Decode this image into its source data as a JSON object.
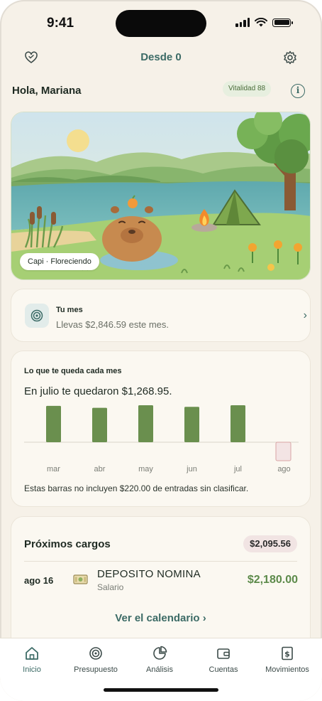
{
  "status_bar": {
    "time": "9:41"
  },
  "header": {
    "title": "Desde 0",
    "left_icon": "heart-icon",
    "right_icon": "gear-icon"
  },
  "greeting": {
    "text": "Hola, Mariana",
    "vitality_badge": "Vitalidad 88",
    "info_icon": "info-icon"
  },
  "scene": {
    "tag": "Capi · Floreciendo"
  },
  "month_card": {
    "title": "Tu mes",
    "subtitle": "Llevas $2,846.59 este mes.",
    "icon": "target-icon",
    "chevron": "›"
  },
  "leftover_card": {
    "title": "Lo que te queda cada mes",
    "summary": "En julio te quedaron $1,268.95.",
    "note": "Estas barras no incluyen $220.00 de entradas sin clasificar."
  },
  "chart_data": {
    "type": "bar",
    "categories": [
      "mar",
      "abr",
      "may",
      "jun",
      "jul",
      "ago"
    ],
    "values": [
      1250,
      1180,
      1270,
      1215,
      1268.95,
      0
    ],
    "highlight_last_as_pending": true,
    "colors": {
      "bar": "#6a8f4e",
      "pending": "#f3e4e4",
      "pending_border": "#d9a5a5"
    }
  },
  "charges_card": {
    "title": "Próximos cargos",
    "total": "$2,095.56",
    "items": [
      {
        "date": "ago 16",
        "icon": "cash-icon",
        "name": "DEPOSITO NOMINA",
        "category": "Salario",
        "amount": "$2,180.00"
      }
    ],
    "calendar_link": "Ver el calendario  ›"
  },
  "tab_bar": {
    "items": [
      {
        "label": "Inicio",
        "icon": "home-icon",
        "active": true
      },
      {
        "label": "Presupuesto",
        "icon": "target-icon",
        "active": false
      },
      {
        "label": "Análisis",
        "icon": "pie-chart-icon",
        "active": false
      },
      {
        "label": "Cuentas",
        "icon": "wallet-icon",
        "active": false
      },
      {
        "label": "Movimientos",
        "icon": "receipt-icon",
        "active": false
      }
    ]
  },
  "colors": {
    "accent": "#3c6b66",
    "positive": "#5c8a4a",
    "background": "#f6f1e8"
  }
}
